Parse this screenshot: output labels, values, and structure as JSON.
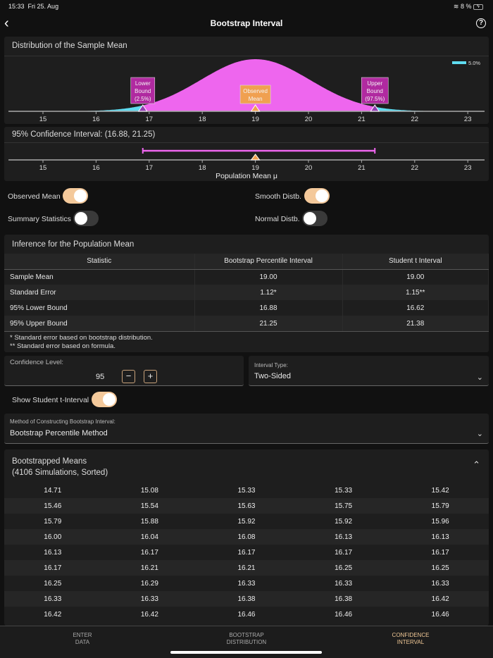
{
  "status_bar": {
    "time": "15:33",
    "date": "Fri 25. Aug",
    "battery": "8 %"
  },
  "nav": {
    "title": "Bootstrap Interval",
    "back_icon": "chevron-left",
    "help_icon": "question-circle"
  },
  "distribution": {
    "title": "Distribution of the Sample Mean",
    "legend": "5.0%",
    "lower_label": [
      "Lower",
      "Bound",
      "(2.5%)"
    ],
    "observed_label": [
      "Observed",
      "Mean"
    ],
    "upper_label": [
      "Upper",
      "Bound",
      "(97.5%)"
    ]
  },
  "ci": {
    "title": "95% Confidence Interval: (16.88, 21.25)",
    "axis_title": "Population Mean μ"
  },
  "chart_data": {
    "type": "area",
    "x_ticks": [
      "15",
      "16",
      "17",
      "18",
      "19",
      "20",
      "21",
      "22",
      "23"
    ],
    "xlim": [
      14.35,
      23.3
    ],
    "observed_mean": 19.0,
    "standard_error": 1.12,
    "lower_bound": 16.88,
    "upper_bound": 21.25,
    "tail_percent": 5.0,
    "colors": {
      "body": "#ee66ee",
      "tails": "#5fdcf0",
      "observed": "#f0a050",
      "bound_box": "#b02aa0"
    }
  },
  "toggles": {
    "observed_mean": {
      "label": "Observed Mean",
      "on": true
    },
    "smooth": {
      "label": "Smooth Distb.",
      "on": true
    },
    "summary": {
      "label": "Summary Statistics",
      "on": false
    },
    "normal": {
      "label": "Normal Distb.",
      "on": false
    }
  },
  "inference": {
    "title": "Inference for the Population Mean",
    "headers": [
      "Statistic",
      "Bootstrap Percentile Interval",
      "Student t Interval"
    ],
    "rows": [
      [
        "Sample Mean",
        "19.00",
        "19.00"
      ],
      [
        "Standard Error",
        "1.12*",
        "1.15**"
      ],
      [
        "95% Lower Bound",
        "16.88",
        "16.62"
      ],
      [
        "95% Upper Bound",
        "21.25",
        "21.38"
      ]
    ],
    "notes": [
      "* Standard error based on bootstrap distribution.",
      "** Standard error based on formula."
    ]
  },
  "confidence": {
    "label": "Confidence Level:",
    "value": "95",
    "minus": "−",
    "plus": "+"
  },
  "interval_type": {
    "label": "Interval Type:",
    "value": "Two-Sided"
  },
  "show_t": {
    "label": "Show Student t-Interval",
    "on": true
  },
  "method": {
    "label": "Method of Constructing Bootstrap Interval:",
    "value": "Bootstrap Percentile Method"
  },
  "means": {
    "title": "Bootstrapped Means",
    "subtitle": "(4106 Simulations, Sorted)",
    "rows": [
      [
        "14.71",
        "15.08",
        "15.33",
        "15.33",
        "15.42"
      ],
      [
        "15.46",
        "15.54",
        "15.63",
        "15.75",
        "15.79"
      ],
      [
        "15.79",
        "15.88",
        "15.92",
        "15.92",
        "15.96"
      ],
      [
        "16.00",
        "16.04",
        "16.08",
        "16.13",
        "16.13"
      ],
      [
        "16.13",
        "16.17",
        "16.17",
        "16.17",
        "16.17"
      ],
      [
        "16.17",
        "16.21",
        "16.21",
        "16.25",
        "16.25"
      ],
      [
        "16.25",
        "16.29",
        "16.33",
        "16.33",
        "16.33"
      ],
      [
        "16.33",
        "16.33",
        "16.38",
        "16.38",
        "16.42"
      ],
      [
        "16.42",
        "16.42",
        "16.46",
        "16.46",
        "16.46"
      ]
    ]
  },
  "tabs": [
    [
      "ENTER",
      "DATA"
    ],
    [
      "BOOTSTRAP",
      "DISTRIBUTION"
    ],
    [
      "CONFIDENCE",
      "INTERVAL"
    ]
  ]
}
